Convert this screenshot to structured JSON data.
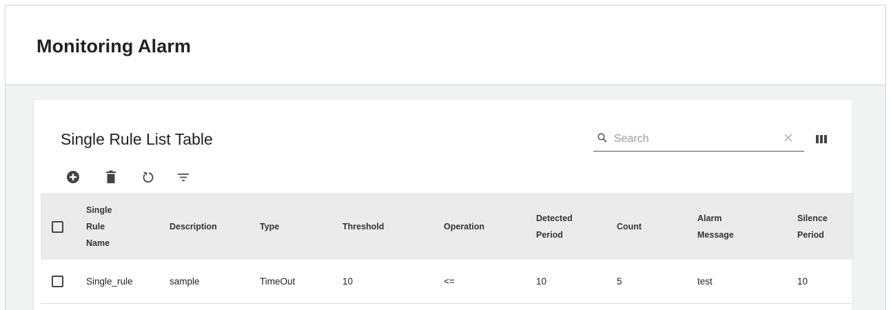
{
  "header": {
    "title": "Monitoring Alarm"
  },
  "card": {
    "title": "Single Rule List Table",
    "search": {
      "placeholder": "Search",
      "value": ""
    },
    "icons": {
      "search": "search-icon",
      "clear": "close-icon",
      "columns": "view-column-icon",
      "add": "add-circle-icon",
      "delete": "trash-icon",
      "refresh": "refresh-icon",
      "filter": "filter-icon"
    }
  },
  "table": {
    "columns": [
      "Single\nRule\nName",
      "Description",
      "Type",
      "Threshold",
      "Operation",
      "Detected\nPeriod",
      "Count",
      "Alarm\nMessage",
      "Silence\nPeriod"
    ],
    "rows": [
      [
        "Single_rule",
        "sample",
        "TimeOut",
        "10",
        "<=",
        "10",
        "5",
        "test",
        "10"
      ]
    ]
  },
  "colors": {
    "header_bg": "#ebebeb",
    "page_bg": "#f1f3f3",
    "icon": "#444444"
  }
}
